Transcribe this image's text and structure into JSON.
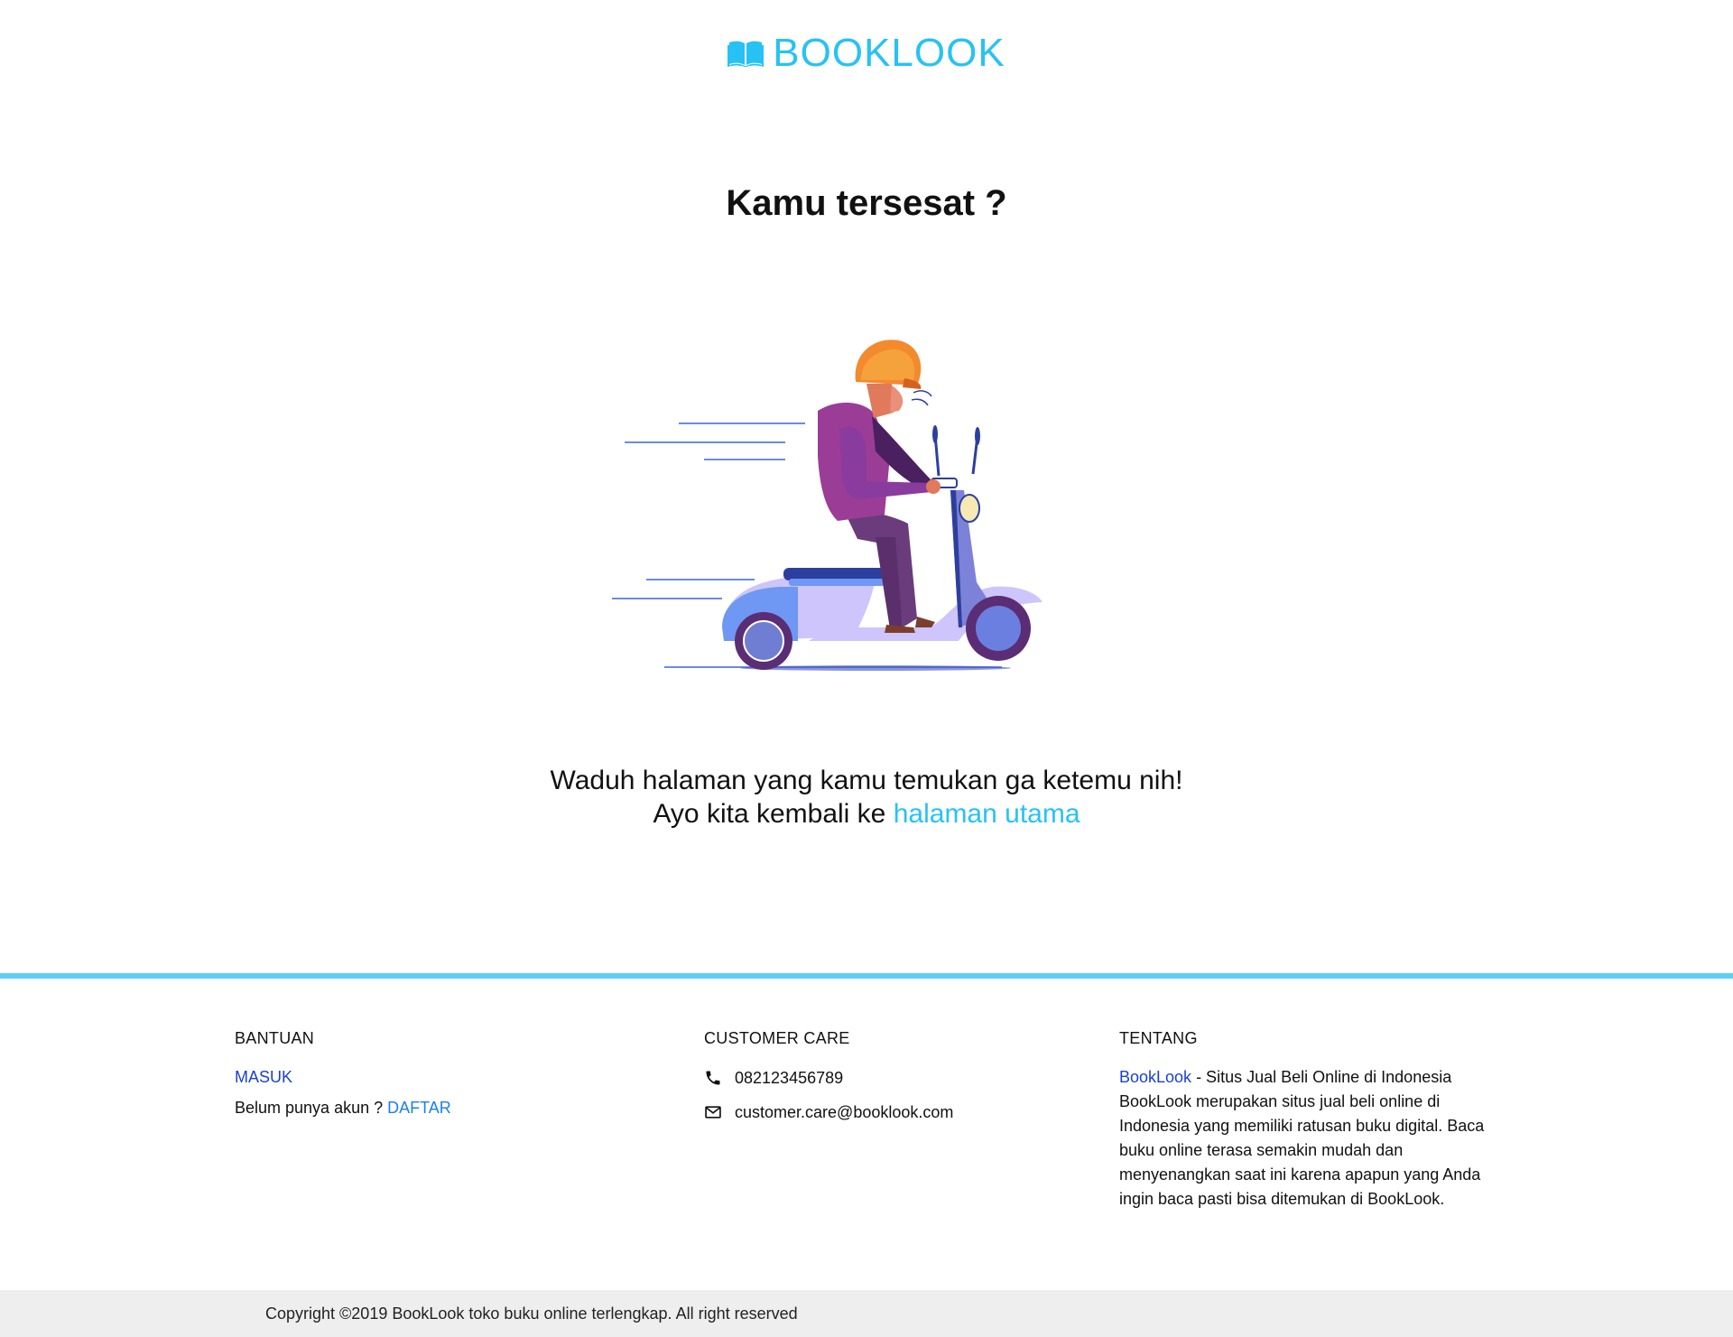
{
  "brand": {
    "name": "BOOKLOOK",
    "color": "#27c2f4"
  },
  "notfound": {
    "title": "Kamu tersesat ?",
    "line1": "Waduh halaman yang kamu temukan ga ketemu nih!",
    "line2_prefix": "Ayo kita kembali ke ",
    "home_link": "halaman utama"
  },
  "illustration": {
    "subject": "person-riding-scooter"
  },
  "footer": {
    "accent_line_color": "#5ad0f3",
    "bantuan": {
      "heading": "BANTUAN",
      "login": "MASUK",
      "no_account": "Belum punya akun ?",
      "register": "DAFTAR"
    },
    "customer_care": {
      "heading": "CUSTOMER CARE",
      "phone_icon": "phone-icon",
      "phone": "082123456789",
      "email_icon": "mail-icon",
      "email": "customer.care@booklook.com"
    },
    "tentang": {
      "heading": "TENTANG",
      "brand_link": "BookLook",
      "text": " - Situs Jual Beli Online di Indonesia BookLook merupakan situs jual beli online di Indonesia yang memiliki ratusan buku digital. Baca buku online terasa semakin mudah dan menyenangkan saat ini karena apapun yang Anda ingin baca pasti bisa ditemukan di BookLook."
    },
    "copyright": "Copyright ©2019 BookLook toko buku online terlengkap. All right reserved"
  }
}
